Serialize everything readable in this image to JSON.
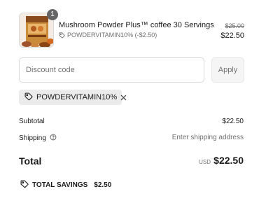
{
  "product": {
    "image_icon": "product-thumbnail-image",
    "quantity": "1",
    "title": "Mushroom Powder Plus™ coffee 30 Servings",
    "discount_label": "POWDERVITAMIN10% (-$2.50)",
    "original_price": "$25.00",
    "price": "$22.50"
  },
  "discount": {
    "placeholder": "Discount code",
    "apply_label": "Apply",
    "applied_code": "POWDERVITAMIN10%"
  },
  "summary": {
    "subtotal_label": "Subtotal",
    "subtotal_value": "$22.50",
    "shipping_label": "Shipping",
    "shipping_value": "Enter shipping address",
    "total_label": "Total",
    "currency": "USD",
    "total_value": "$22.50",
    "savings_label": "TOTAL SAVINGS",
    "savings_value": "$2.50"
  },
  "icons": {
    "tag": "tag-icon",
    "close": "close-icon",
    "help": "help-circle-icon"
  }
}
